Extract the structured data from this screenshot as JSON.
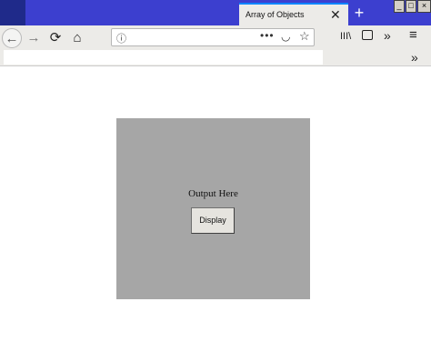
{
  "window": {
    "tab_title": "Array of Objects",
    "tab_close_glyph": "✕",
    "new_tab_glyph": "+",
    "min_glyph": "_",
    "max_glyph": "□",
    "close_glyph": "×"
  },
  "navbar": {
    "back_glyph": "←",
    "forward_glyph": "→",
    "reload_glyph": "⟳",
    "home_glyph": "⌂",
    "info_glyph": "ⓘ",
    "url_value": "",
    "page_actions_glyph": "•••",
    "pocket_glyph": "◡",
    "star_glyph": "☆",
    "library_glyph": "III\\",
    "overflow_glyph": "»",
    "menu_glyph": "≡"
  },
  "bookmarks": {
    "overflow_glyph": "»"
  },
  "page": {
    "output_text": "Output Here",
    "display_button": "Display"
  },
  "colors": {
    "tabstrip": "#3c3fcf",
    "toolbar": "#ecebe8",
    "content_box": "#a6a6a6",
    "button_face": "#e6e4df"
  }
}
